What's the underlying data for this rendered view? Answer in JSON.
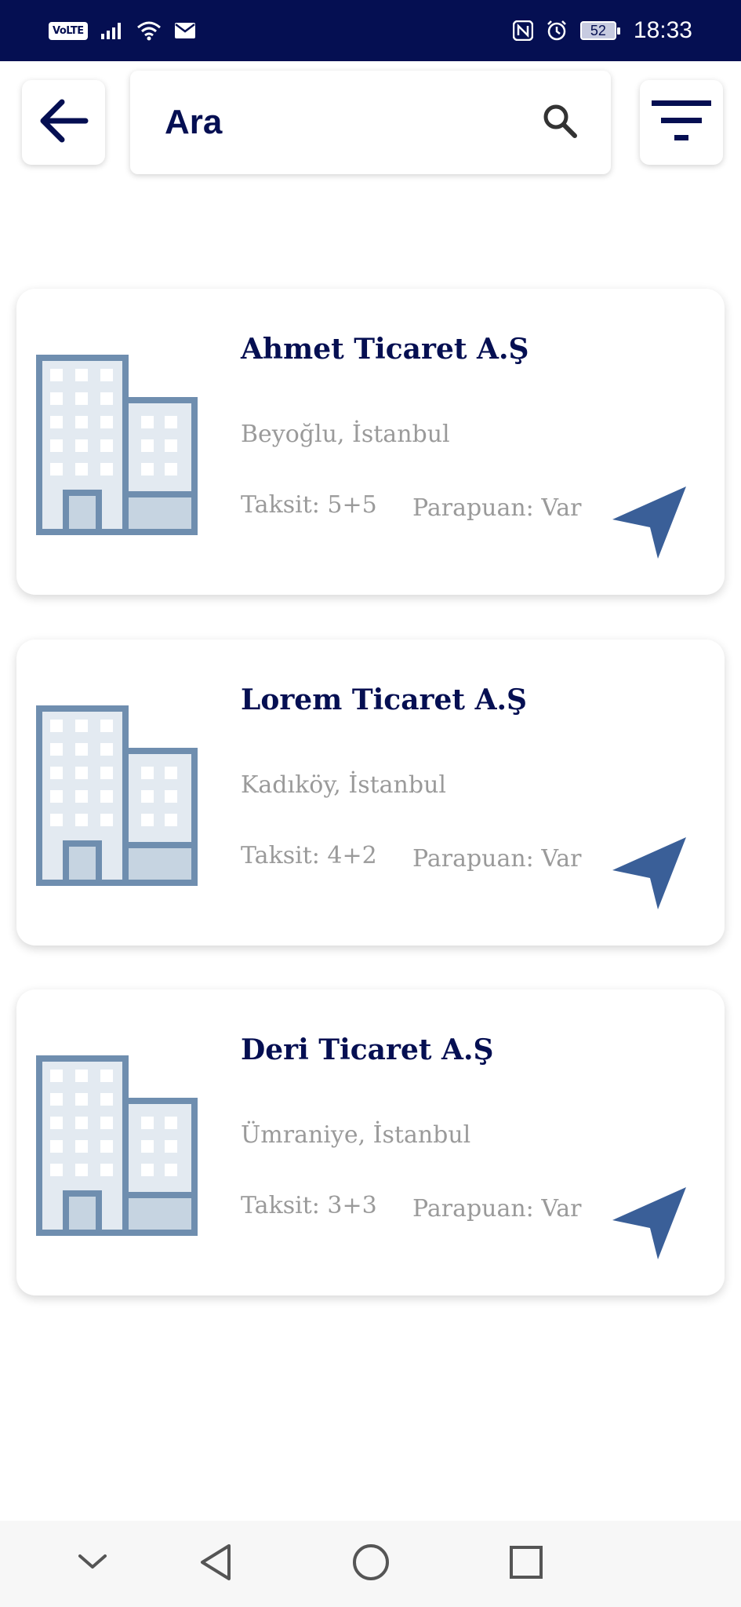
{
  "status_bar": {
    "network_label": "VoLTE",
    "battery_level": "52",
    "time": "18:33",
    "icons": [
      "signal-icon",
      "wifi-icon",
      "mail-icon",
      "nfc-icon",
      "alarm-icon",
      "battery-icon"
    ]
  },
  "header": {
    "back_icon": "arrow-left-icon",
    "search_placeholder": "Ara",
    "search_icon": "search-icon",
    "filter_icon": "filter-icon"
  },
  "companies": [
    {
      "name": "Ahmet Ticaret A.Ş",
      "location": "Beyoğlu, İstanbul",
      "taksit": "Taksit: 5+5",
      "parapuan": "Parapuan: Var"
    },
    {
      "name": "Lorem Ticaret A.Ş",
      "location": "Kadıköy, İstanbul",
      "taksit": "Taksit: 4+2",
      "parapuan": "Parapuan: Var"
    },
    {
      "name": "Deri Ticaret A.Ş",
      "location": "Ümraniye, İstanbul",
      "taksit": "Taksit: 3+3",
      "parapuan": "Parapuan: Var"
    }
  ],
  "system_nav": {
    "icons": [
      "chevron-down-icon",
      "back-triangle-icon",
      "home-circle-icon",
      "recents-square-icon"
    ]
  },
  "colors": {
    "status_bar": "#050f52",
    "title": "#050f52",
    "secondary_text": "#9a9a9a",
    "building": "#6f8eaf",
    "nav_arrow": "#3a5f98"
  }
}
